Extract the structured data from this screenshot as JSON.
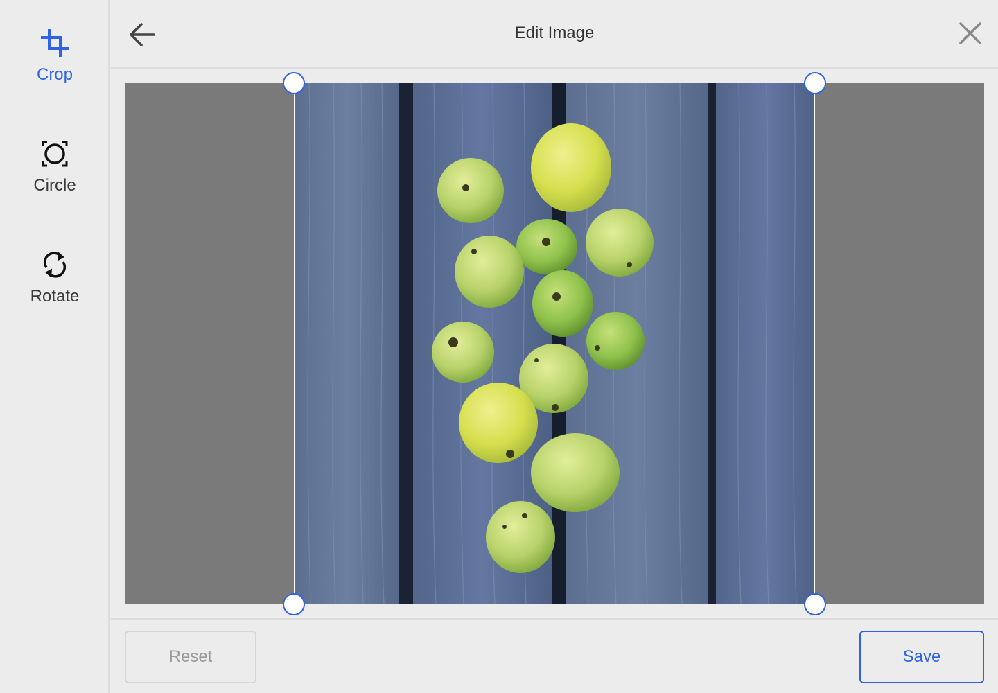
{
  "dialog": {
    "title": "Edit Image"
  },
  "sidebar": {
    "tools": [
      {
        "label": "Crop",
        "icon": "crop-icon",
        "active": true
      },
      {
        "label": "Circle",
        "icon": "circle-icon",
        "active": false
      },
      {
        "label": "Rotate",
        "icon": "rotate-icon",
        "active": false
      }
    ]
  },
  "image": {
    "alt": "Green apples on weathered blue wooden planks"
  },
  "footer": {
    "reset_label": "Reset",
    "save_label": "Save"
  },
  "colors": {
    "accent": "#2f63e6",
    "background": "#ececec",
    "canvas_mask": "#7a7a7a"
  }
}
